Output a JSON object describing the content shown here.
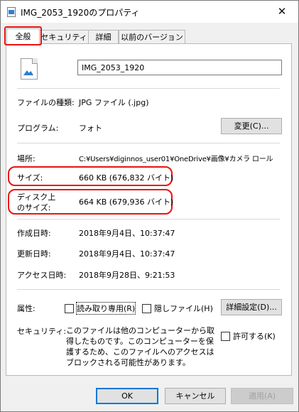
{
  "window": {
    "title": "IMG_2053_1920のプロパティ",
    "close_glyph": "✕"
  },
  "tabs": [
    {
      "label": "全般"
    },
    {
      "label": "セキュリティ"
    },
    {
      "label": "詳細"
    },
    {
      "label": "以前のバージョン"
    }
  ],
  "general": {
    "file_name": "IMG_2053_1920",
    "file_type_label": "ファイルの種類:",
    "file_type_value": "JPG ファイル (.jpg)",
    "program_label": "プログラム:",
    "program_value": "フォト",
    "change_button": "変更(C)...",
    "location_label": "場所:",
    "location_value": "C:¥Users¥diginnos_user01¥OneDrive¥画像¥カメラ ロール",
    "size_label": "サイズ:",
    "size_value": "660 KB (676,832 バイト)",
    "disk_size_label_line1": "ディスク上",
    "disk_size_label_line2": "のサイズ:",
    "disk_size_value": "664 KB (679,936 バイト)",
    "created_label": "作成日時:",
    "created_value": "2018年9月4日、10:37:47",
    "modified_label": "更新日時:",
    "modified_value": "2018年9月4日、10:37:47",
    "accessed_label": "アクセス日時:",
    "accessed_value": "2018年9月28日、9:21:53",
    "attributes_label": "属性:",
    "readonly_label": "読み取り専用(R)",
    "hidden_label": "隠しファイル(H)",
    "advanced_button": "詳細設定(D)...",
    "security_label": "セキュリティ:",
    "security_text": "このファイルは他のコンピューターから取得したものです。このコンピューターを保護するため、このファイルへのアクセスはブロックされる可能性があります。",
    "allow_label": "許可する(K)"
  },
  "footer": {
    "ok": "OK",
    "cancel": "キャンセル",
    "apply": "適用(A)"
  },
  "colors": {
    "highlight": "#e11111",
    "accent": "#0078d7"
  }
}
